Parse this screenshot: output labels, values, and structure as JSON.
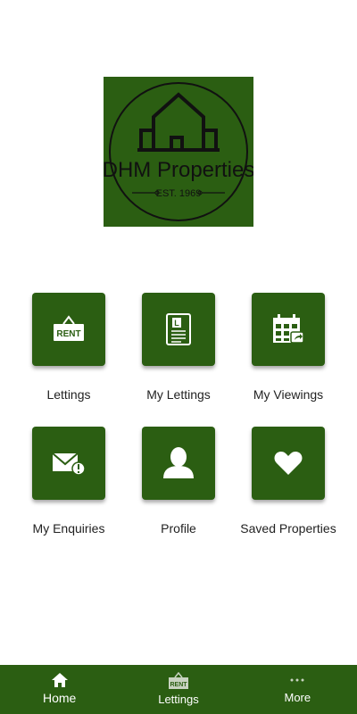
{
  "logo": {
    "brand": "DHM Properties",
    "established": "EST. 1969",
    "background": "#2b5e12"
  },
  "tiles": [
    {
      "label": "Lettings",
      "icon": "rent-sign-icon"
    },
    {
      "label": "My Lettings",
      "icon": "lettings-document-icon"
    },
    {
      "label": "My Viewings",
      "icon": "calendar-share-icon"
    },
    {
      "label": "My Enquiries",
      "icon": "mail-alert-icon"
    },
    {
      "label": "Profile",
      "icon": "person-icon"
    },
    {
      "label": "Saved Properties",
      "icon": "heart-icon"
    }
  ],
  "tabbar": {
    "home": "Home",
    "lettings": "Lettings",
    "more": "More",
    "rent_badge": "RENT",
    "active": "home"
  },
  "icons": {
    "rent_sign_text": "RENT",
    "document_letter": "L"
  },
  "colors": {
    "brand_green": "#2b5e12",
    "label_text": "#222222"
  }
}
